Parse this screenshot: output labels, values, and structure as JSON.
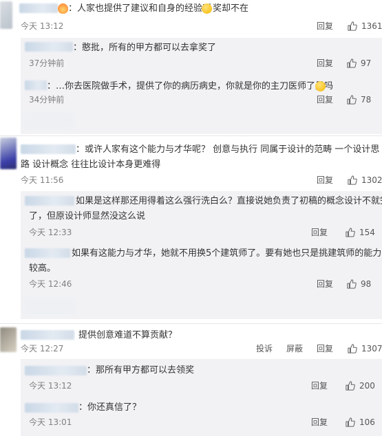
{
  "comments": [
    {
      "text": "：人家也提供了建议和自身的经验呀",
      "text_tail": "奖却不在",
      "time": "今天 13:12",
      "reply_label": "回复",
      "likes": "1361",
      "replies": [
        {
          "text": "：憨批，所有的甲方都可以去拿奖了",
          "time": "37分钟前",
          "reply_label": "回复",
          "likes": "97"
        },
        {
          "text": "：…你去医院做手术，提供了你的病历病史，你就是你的主刀医师了是吗",
          "time": "34分钟前",
          "reply_label": "回复",
          "likes": "78"
        }
      ]
    },
    {
      "line1": "：或许人家有这个能力与才华呢？  创意与执行  同属于设计的范畴  一个设计思",
      "line2": "路 设计概念 往往比设计本身更难得",
      "time": "今天 11:56",
      "reply_label": "回复",
      "likes": "1302",
      "replies": [
        {
          "line1": "如果是这样那还用得着这么强行洗白么？直接说她负责了初稿的概念设计不就完",
          "line2": "了，但原设计师显然没这么说",
          "time": "今天 12:33",
          "reply_label": "回复",
          "likes": "154"
        },
        {
          "line1": "如果有这能力与才华，她就不用换5个建筑师了。要有她也只是挑建筑师的能力比",
          "line2": "较高。",
          "time": "今天 12:46",
          "reply_label": "回复",
          "likes": "98"
        }
      ]
    },
    {
      "text": "提供创意难道不算贡献？",
      "time": "今天 12:27",
      "report_label": "投诉",
      "block_label": "屏蔽",
      "reply_label": "回复",
      "likes": "1307",
      "replies": [
        {
          "text": "：那所有甲方都可以去领奖",
          "time": "今天 13:12",
          "reply_label": "回复",
          "likes": "200"
        },
        {
          "text": "：你还真信了？",
          "time": "今天 13:01",
          "reply_label": "回复",
          "likes": "106"
        }
      ]
    }
  ],
  "icons": {
    "like": "thumb-up-icon",
    "emoji_smile": "smile-emoji-icon",
    "emoji_fire": "fire-emoji-icon"
  }
}
